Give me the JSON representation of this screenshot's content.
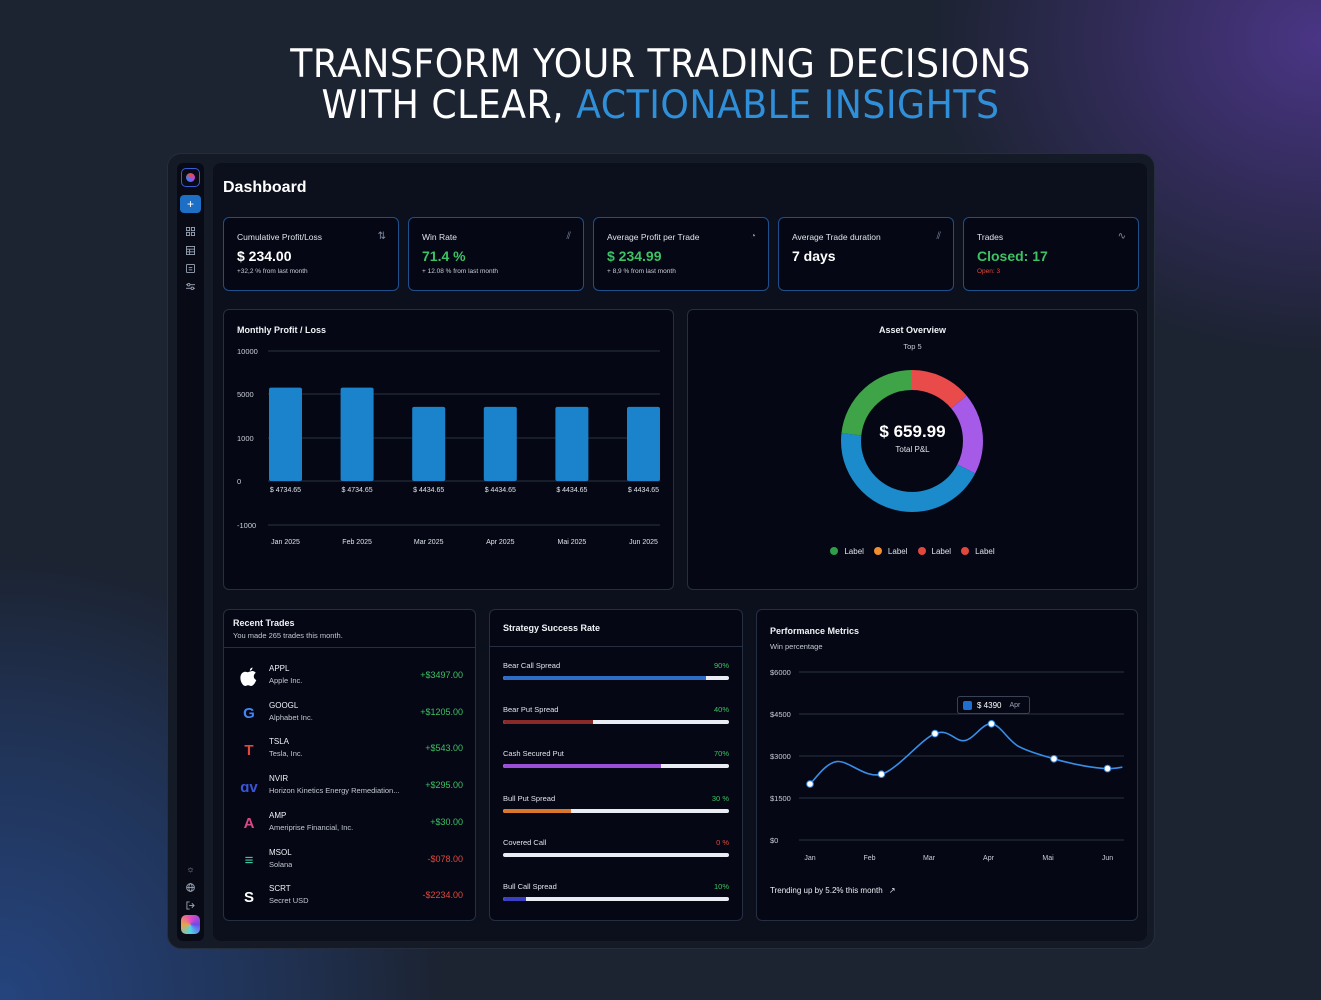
{
  "headline": {
    "line1": "TRANSFORM YOUR TRADING DECISIONS",
    "line2_prefix": "WITH CLEAR,",
    "line2_accent": "ACTIONABLE INSIGHTS"
  },
  "sidebar": {
    "icons": [
      "logo-icon",
      "plus-icon",
      "grid-icon",
      "table-icon",
      "report-icon",
      "sliders-icon",
      "sun-icon",
      "globe-icon",
      "logout-icon",
      "avatar"
    ]
  },
  "page_title": "Dashboard",
  "stats": [
    {
      "label": "Cumulative Profit/Loss",
      "icon": "sort-arrows-icon",
      "value": "$ 234.00",
      "value_color": "white",
      "sub": "+32,2 %  from last month"
    },
    {
      "label": "Win Rate",
      "icon": "chart-icon",
      "value": "71.4 %",
      "value_color": "green",
      "sub": "+ 12.08 %  from last month"
    },
    {
      "label": "Average Profit per Trade",
      "icon": "pie-icon",
      "value": "$ 234.99",
      "value_color": "green",
      "sub": "+ 8,9 %  from last month"
    },
    {
      "label": "Average Trade duration",
      "icon": "chart-icon",
      "value": "7 days",
      "value_color": "white",
      "sub": ""
    },
    {
      "label": "Trades",
      "icon": "pulse-icon",
      "value": "Closed: 17",
      "value_color": "green",
      "sub": "Open: 3"
    }
  ],
  "monthly_chart": {
    "title": "Monthly Profit / Loss",
    "y_ticks": [
      "10000",
      "5000",
      "1000",
      "0",
      "-1000"
    ]
  },
  "asset_overview": {
    "title": "Asset Overview",
    "subtitle": "Top 5",
    "total_value": "$ 659.99",
    "total_label": "Total P&L",
    "segments": [
      {
        "color": "#e94a4a",
        "value": 12
      },
      {
        "color": "#a55ae8",
        "value": 16
      },
      {
        "color": "#1b8bcb",
        "value": 38
      },
      {
        "color": "#3fa347",
        "value": 20
      }
    ],
    "legend": [
      {
        "label": "Label",
        "color": "#2f9e48"
      },
      {
        "label": "Label",
        "color": "#f08d2e"
      },
      {
        "label": "Label",
        "color": "#e2473d"
      },
      {
        "label": "Label",
        "color": "#e2473d"
      }
    ]
  },
  "recent_trades": {
    "title": "Recent Trades",
    "subtitle": "You made 265 trades this month.",
    "items": [
      {
        "symbol": "APPL",
        "name": "Apple Inc.",
        "value": "+$3497.00",
        "positive": true,
        "logo": "apple-logo-icon"
      },
      {
        "symbol": "GOOGL",
        "name": "Alphabet Inc.",
        "value": "+$1205.00",
        "positive": true,
        "logo": "google-logo-icon"
      },
      {
        "symbol": "TSLA",
        "name": "Tesla, Inc.",
        "value": "+$543.00",
        "positive": true,
        "logo": "tesla-logo-icon"
      },
      {
        "symbol": "NVIR",
        "name": "Horizon Kinetics Energy Remediation...",
        "value": "+$295.00",
        "positive": true,
        "logo": "nvir-logo-icon"
      },
      {
        "symbol": "AMP",
        "name": "Ameriprise Financial, Inc.",
        "value": "+$30.00",
        "positive": true,
        "logo": "amp-logo-icon"
      },
      {
        "symbol": "MSOL",
        "name": "Solana",
        "value": "-$078.00",
        "positive": false,
        "logo": "solana-logo-icon"
      },
      {
        "symbol": "SCRT",
        "name": "Secret USD",
        "value": "-$2234.00",
        "positive": false,
        "logo": "secret-logo-icon"
      }
    ]
  },
  "strategy": {
    "title": "Strategy Success Rate",
    "items": [
      {
        "name": "Bear Call Spread",
        "pct_label": "90%",
        "fill": 0.9,
        "color": "#2f6dc4"
      },
      {
        "name": "Bear Put Spread",
        "pct_label": "40%",
        "fill": 0.4,
        "color": "#8a2a28"
      },
      {
        "name": "Cash Secured Put",
        "pct_label": "70%",
        "fill": 0.7,
        "color": "#9b4fd6"
      },
      {
        "name": "Bull Put Spread",
        "pct_label": "30 %",
        "fill": 0.3,
        "color": "#d9782c"
      },
      {
        "name": "Covered Call",
        "pct_label": "0 %",
        "fill": 0.0,
        "color": "#e2473d",
        "pct_negative": true
      },
      {
        "name": "Bull Call Spread",
        "pct_label": "10%",
        "fill": 0.1,
        "color": "#3a3fc4"
      }
    ]
  },
  "performance": {
    "title": "Performance Metrics",
    "subtitle": "Win percentage",
    "tooltip_value": "$ 4390",
    "tooltip_label": "Apr",
    "footer": "Trending up by 5.2% this month"
  },
  "chart_data": [
    {
      "type": "bar",
      "title": "Monthly Profit / Loss",
      "categories": [
        "Jan 2025",
        "Feb 2025",
        "Mar 2025",
        "Apr 2025",
        "Mai 2025",
        "Jun 2025"
      ],
      "values": [
        4734.65,
        4734.65,
        4434.65,
        4434.65,
        4434.65,
        4434.65
      ],
      "data_labels": [
        "$ 4734.65",
        "$ 4734.65",
        "$ 4434.65",
        "$ 4434.65",
        "$ 4434.65",
        "$ 4434.65"
      ],
      "y_ticks": [
        10000,
        5000,
        1000,
        0,
        -1000
      ],
      "grid": true
    },
    {
      "type": "line",
      "title": "Performance Metrics",
      "categories": [
        "Jan",
        "Feb",
        "Mar",
        "Apr",
        "Mai",
        "Jun"
      ],
      "x": [
        0,
        1,
        1.45,
        2,
        2.55,
        3,
        3.5,
        4,
        4.5,
        5,
        5.5
      ],
      "y": [
        2000,
        2700,
        2350,
        3200,
        3800,
        3400,
        4150,
        3100,
        2900,
        2550,
        2500
      ],
      "points_x": [
        0,
        1.2,
        2.1,
        3.05,
        4.1,
        5.0
      ],
      "points_y": [
        2000,
        2350,
        3800,
        4150,
        2900,
        2550
      ],
      "y_ticks": [
        "$6000",
        "$4500",
        "$3000",
        "$1500",
        "$0"
      ],
      "ylim": [
        0,
        6000
      ],
      "grid": true,
      "color": "#3a8ee8"
    }
  ]
}
